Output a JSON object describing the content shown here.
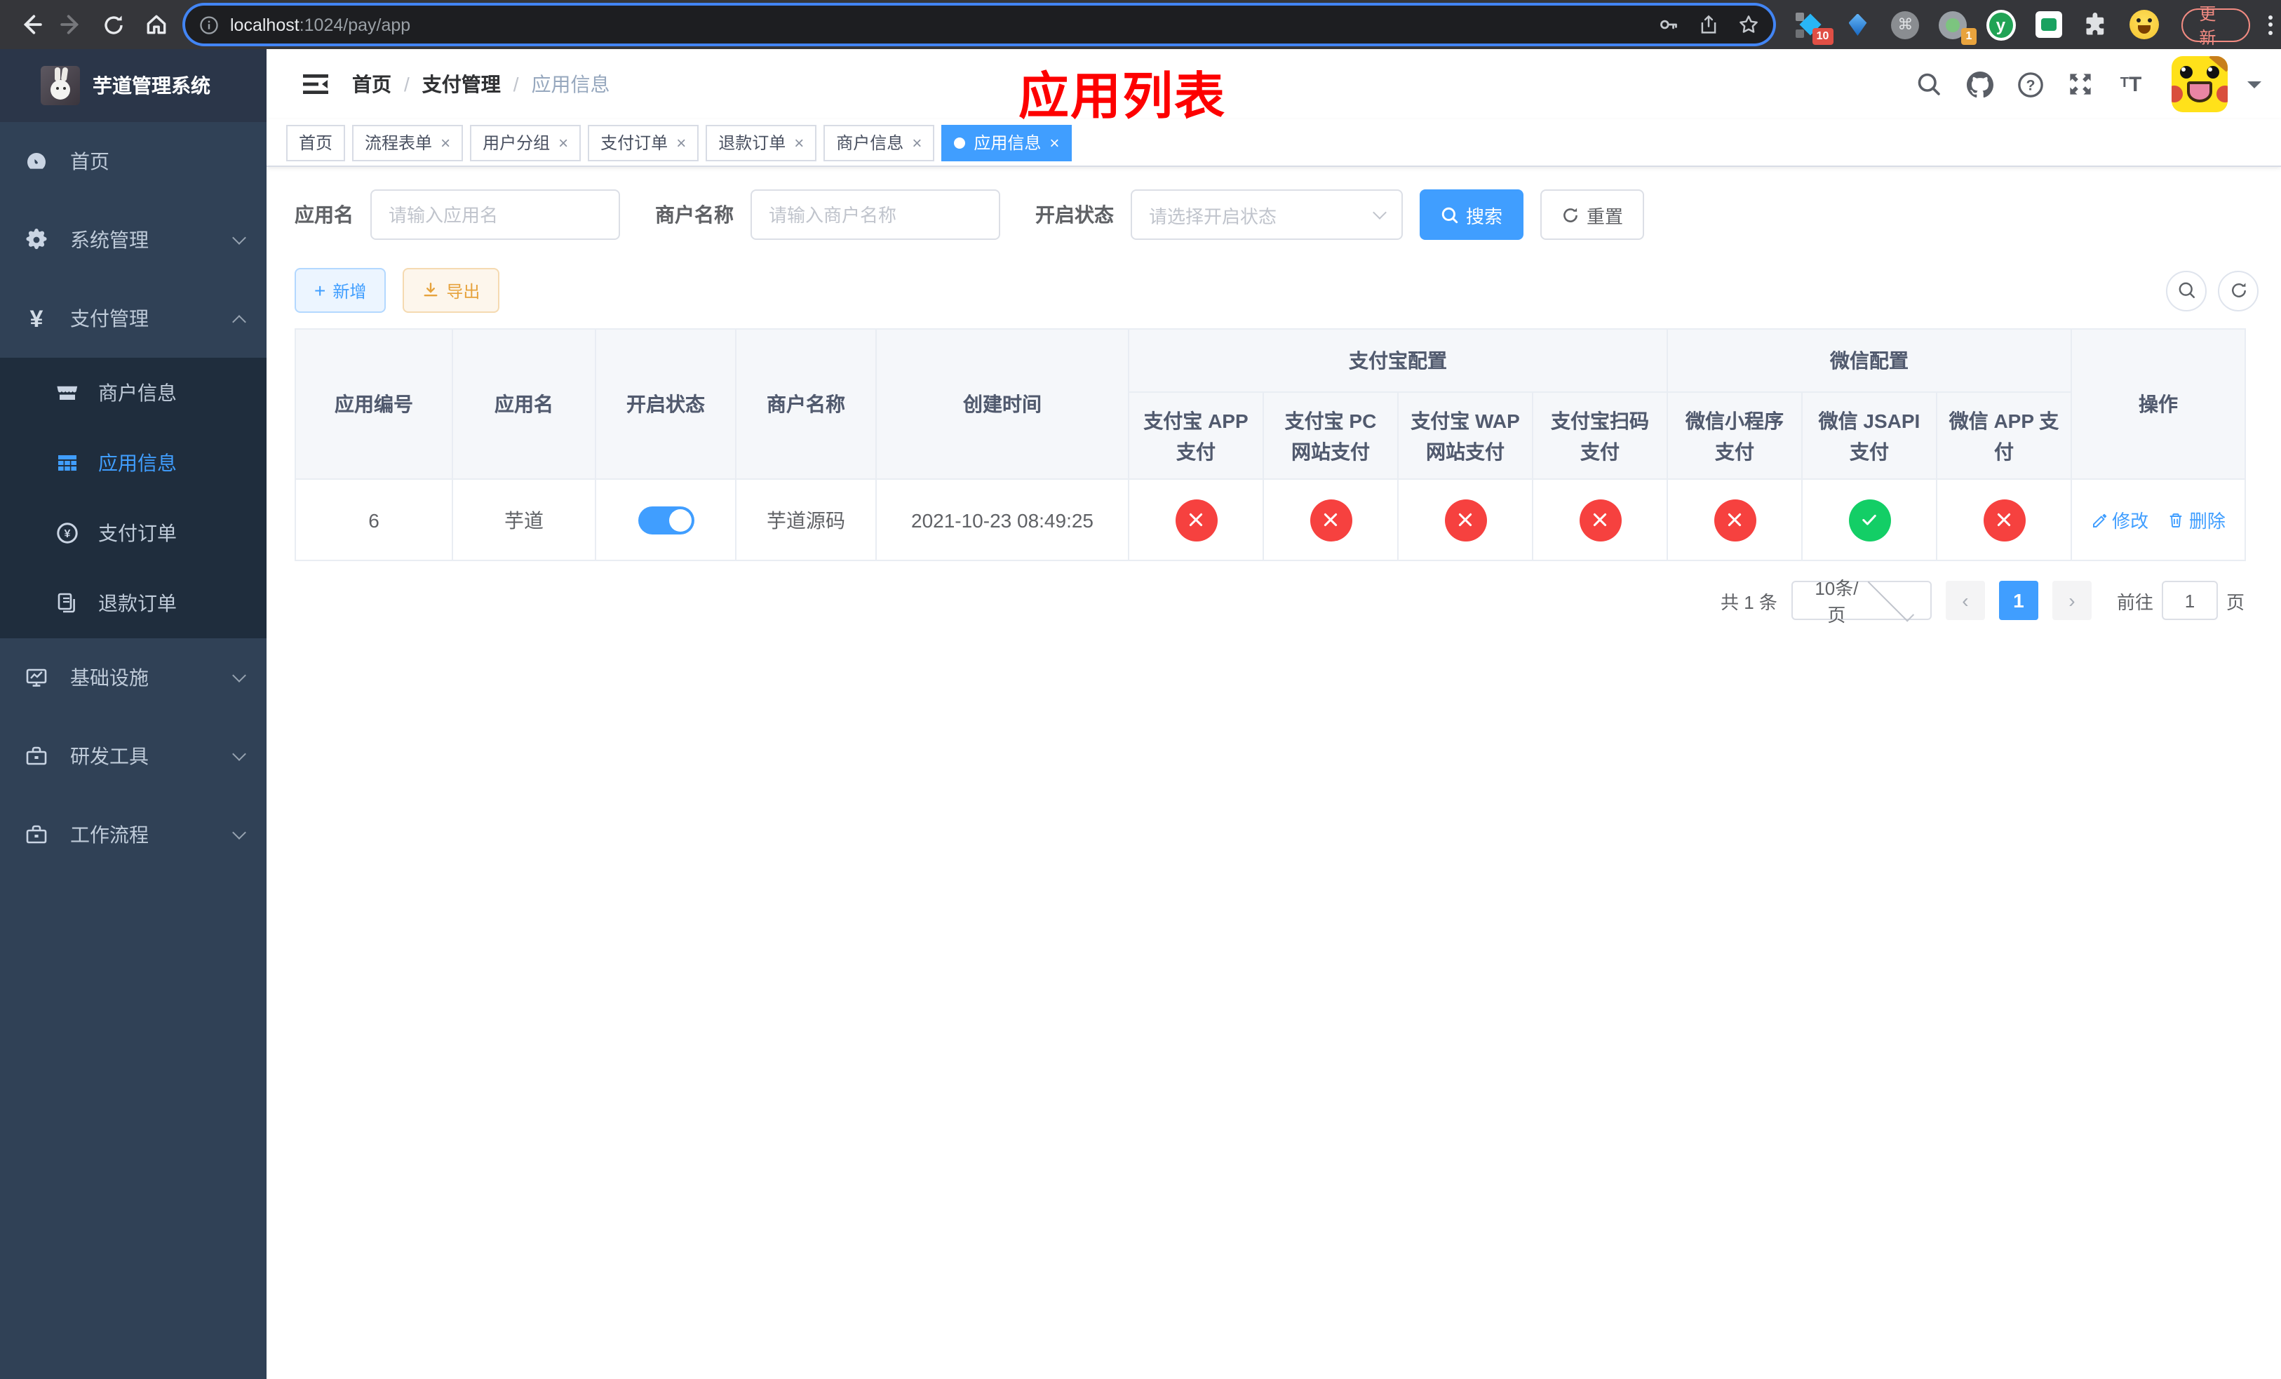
{
  "browser": {
    "url_host": "localhost",
    "url_path": ":1024/pay/app",
    "update_label": "更新",
    "ext1_badge": "10",
    "ext4_badge": "1",
    "ext5_letter": "y"
  },
  "sidebar": {
    "title": "芋道管理系统",
    "items": {
      "home": "首页",
      "system": "系统管理",
      "pay": "支付管理",
      "merchant": "商户信息",
      "app": "应用信息",
      "pay_order": "支付订单",
      "refund_order": "退款订单",
      "infra": "基础设施",
      "devtools": "研发工具",
      "workflow": "工作流程"
    }
  },
  "navbar": {
    "breadcrumb": {
      "home": "首页",
      "section": "支付管理",
      "current": "应用信息"
    },
    "annotation": "应用列表"
  },
  "tabs": [
    {
      "label": "首页"
    },
    {
      "label": "流程表单"
    },
    {
      "label": "用户分组"
    },
    {
      "label": "支付订单"
    },
    {
      "label": "退款订单"
    },
    {
      "label": "商户信息"
    },
    {
      "label": "应用信息"
    }
  ],
  "filters": {
    "app_name_label": "应用名",
    "app_name_placeholder": "请输入应用名",
    "merchant_label": "商户名称",
    "merchant_placeholder": "请输入商户名称",
    "status_label": "开启状态",
    "status_placeholder": "请选择开启状态",
    "search_label": "搜索",
    "reset_label": "重置"
  },
  "toolbar": {
    "add_label": "新增",
    "export_label": "导出"
  },
  "table": {
    "headers": {
      "app_id": "应用编号",
      "app_name": "应用名",
      "status": "开启状态",
      "merchant": "商户名称",
      "create_time": "创建时间",
      "group_alipay": "支付宝配置",
      "group_wechat": "微信配置",
      "alipay_app": "支付宝 APP 支付",
      "alipay_pc": "支付宝 PC 网站支付",
      "alipay_wap": "支付宝 WAP 网站支付",
      "alipay_qr": "支付宝扫码支付",
      "wx_mini": "微信小程序支付",
      "wx_jsapi": "微信 JSAPI 支付",
      "wx_app": "微信 APP 支付",
      "actions": "操作"
    },
    "row": {
      "app_id": "6",
      "app_name": "芋道",
      "status_enabled": "on",
      "merchant": "芋道源码",
      "create_time": "2021-10-23 08:49:25",
      "alipay_app": "disabled",
      "alipay_pc": "disabled",
      "alipay_wap": "disabled",
      "alipay_qr": "disabled",
      "wx_mini": "disabled",
      "wx_jsapi": "enabled",
      "wx_app": "disabled",
      "edit_label": "修改",
      "delete_label": "删除"
    }
  },
  "pagination": {
    "total": "共 1 条",
    "page_size": "10条/页",
    "page": "1",
    "goto_prefix": "前往",
    "goto_value": "1",
    "goto_suffix": "页"
  },
  "colors": {
    "primary": "#409eff",
    "danger": "#f6413f",
    "success": "#13ce66",
    "warning": "#e6a23c",
    "sidebar_bg": "#304156",
    "submenu_bg": "#1f2d3d",
    "annotation": "#fd0000"
  }
}
